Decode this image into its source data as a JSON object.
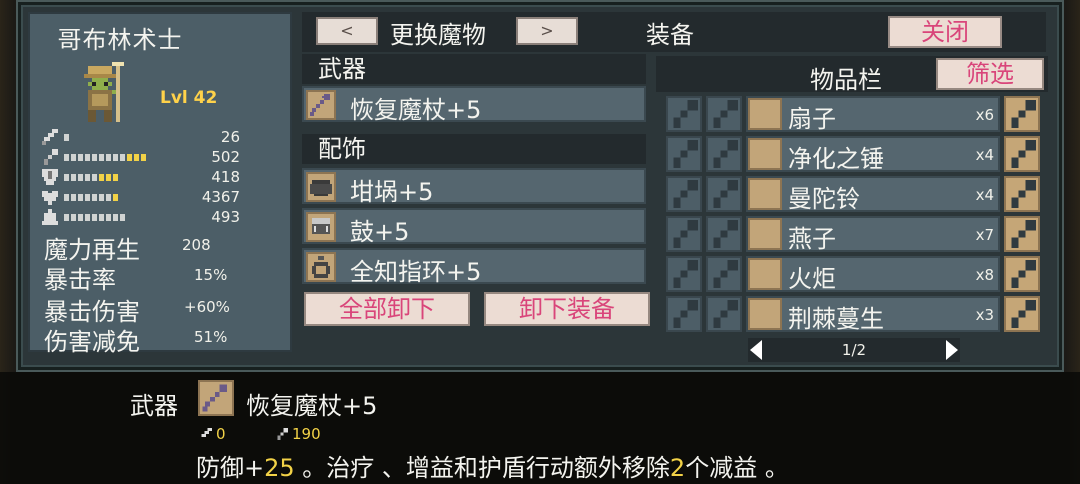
{
  "character": {
    "name": "哥布林术士",
    "level": "Lvl 42",
    "stats": [
      {
        "icon": "dagger-icon",
        "value": "26",
        "bars": 1,
        "yellow": 0
      },
      {
        "icon": "staff-icon",
        "value": "502",
        "bars": 12,
        "yellow": 3
      },
      {
        "icon": "shield-icon",
        "value": "418",
        "bars": 8,
        "yellow": 3
      },
      {
        "icon": "heart-icon",
        "value": "4367",
        "bars": 8,
        "yellow": 1
      },
      {
        "icon": "potion-icon",
        "value": "493",
        "bars": 9,
        "yellow": 0
      }
    ],
    "attributes": [
      {
        "label": "魔力再生",
        "value": "208"
      },
      {
        "label": "暴击率",
        "value": "15%"
      },
      {
        "label": "暴击伤害",
        "value": "+60%"
      },
      {
        "label": "伤害减免",
        "value": "51%"
      }
    ]
  },
  "header": {
    "prev_label": "<",
    "change_monster_label": "更换魔物",
    "next_label": ">",
    "equipment_title": "装备",
    "close_label": "关闭"
  },
  "equipment": {
    "weapon_heading": "武器",
    "weapon": {
      "name": "恢复魔杖+5",
      "icon": "staff-icon"
    },
    "accessory_heading": "配饰",
    "accessories": [
      {
        "name": "坩埚+5",
        "icon": "cauldron-icon"
      },
      {
        "name": "鼓+5",
        "icon": "drum-icon"
      },
      {
        "name": "全知指环+5",
        "icon": "ring-icon"
      }
    ],
    "unequip_all_label": "全部卸下",
    "unequip_label": "卸下装备"
  },
  "inventory": {
    "title": "物品栏",
    "filter_label": "筛选",
    "items": [
      {
        "name": "扇子",
        "qty": "x6"
      },
      {
        "name": "净化之锤",
        "qty": "x4"
      },
      {
        "name": "曼陀铃",
        "qty": "x4"
      },
      {
        "name": "燕子",
        "qty": "x7"
      },
      {
        "name": "火炬",
        "qty": "x8"
      },
      {
        "name": "荆棘蔓生",
        "qty": "x3"
      }
    ],
    "page": "1/2"
  },
  "tooltip": {
    "category": "武器",
    "name": "恢复魔杖+5",
    "stat1": "0",
    "stat2": "190",
    "desc_a": "防御+",
    "desc_b": "25",
    "desc_c": " 。治疗 、增益和护盾行动额外移除",
    "desc_d": "2",
    "desc_e": "个减益 。"
  },
  "colors": {
    "panel": "#4c5e67",
    "button_bg": "#ecdcd3",
    "button_text": "#d9457a",
    "highlight": "#f2d247",
    "slot_gold": "#c2a579"
  }
}
